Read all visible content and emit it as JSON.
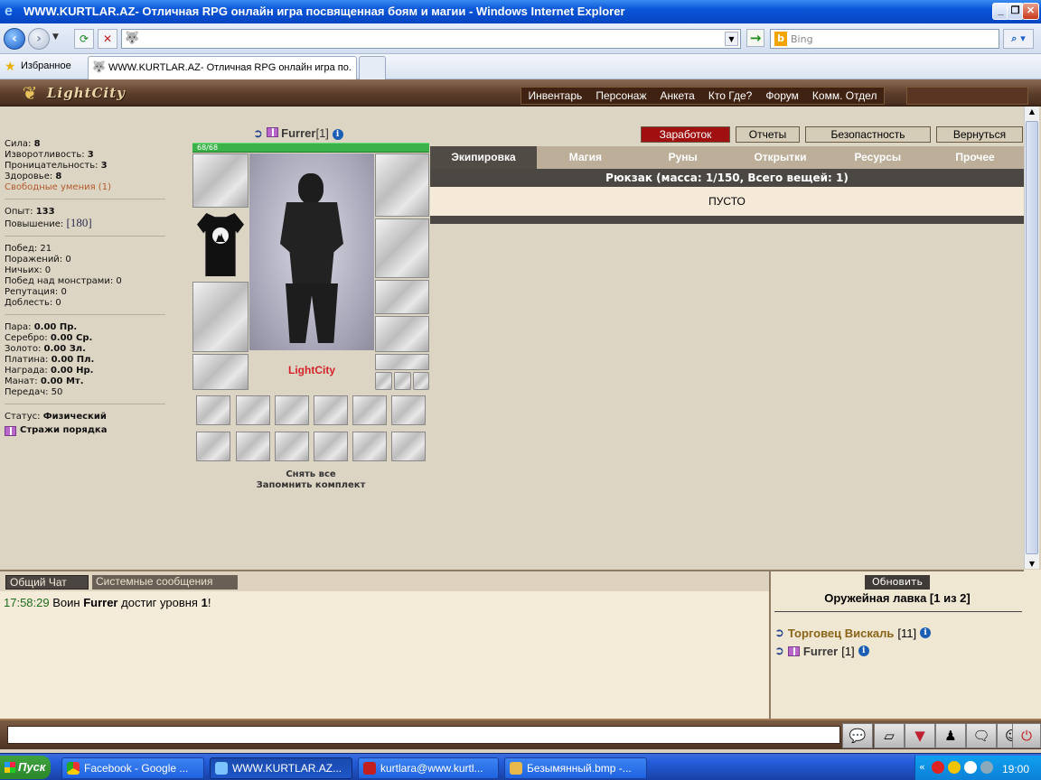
{
  "browser": {
    "title": "WWW.KURTLAR.AZ- Отличная RPG онлайн игра посвященная боям и магии - Windows Internet Explorer",
    "search_placeholder": "Bing",
    "favorites_label": "Избранное",
    "tab_title": "WWW.KURTLAR.AZ- Отличная RPG онлайн игра по..."
  },
  "game": {
    "logo": "LightCity",
    "menu": [
      "Инвентарь",
      "Персонаж",
      "Анкета",
      "Кто Где?",
      "Форум",
      "Комм. Отдел"
    ]
  },
  "stats": {
    "strength_label": "Сила:",
    "strength": "8",
    "agility_label": "Изворотливость:",
    "agility": "3",
    "insight_label": "Проницательность:",
    "insight": "3",
    "health_label": "Здоровье:",
    "health": "8",
    "free_skills": "Свободные умения (1)",
    "exp_label": "Опыт:",
    "exp": "133",
    "levelup_label": "Повышение:",
    "levelup": "[180]",
    "wins": "Побед: 21",
    "losses": "Поражений: 0",
    "draws": "Ничьих: 0",
    "monster_wins": "Побед над монстрами: 0",
    "reputation": "Репутация: 0",
    "valor": "Доблесть: 0",
    "para_label": "Пара:",
    "para": "0.00 Пр.",
    "silver_label": "Серебро:",
    "silver": "0.00 Ср.",
    "gold_label": "Золото:",
    "gold": "0.00 Зл.",
    "platinum_label": "Платина:",
    "platinum": "0.00 Пл.",
    "reward_label": "Награда:",
    "reward": "0.00 Нр.",
    "manat_label": "Манат:",
    "manat": "0.00 Мт.",
    "transfers": "Передач: 50",
    "status_label": "Статус:",
    "status": "Физический",
    "guild": "Стражи порядка"
  },
  "character": {
    "name": "Furrer",
    "level": "[1]",
    "hp_text": "68/68",
    "hp_fraction": 1.0,
    "city_label": "LightCity",
    "undress_all": "Снять все",
    "remember_set": "Запомнить комплект"
  },
  "buttons": {
    "earnings": "Заработок",
    "reports": "Отчеты",
    "security": "Безопастность",
    "return": "Вернуться"
  },
  "inventory": {
    "tabs": [
      "Экипировка",
      "Магия",
      "Руны",
      "Открытки",
      "Ресурсы",
      "Прочее"
    ],
    "backpack_header": "Рюкзак (масса: 1/150, Всего вещей: 1)",
    "empty": "ПУСТО"
  },
  "chat": {
    "tab_general": "Общий Чат",
    "tab_system": "Системные сообщения",
    "msg_time": "17:58:29",
    "msg_pre": "Воин",
    "msg_name": "Furrer",
    "msg_mid": "достиг уровня",
    "msg_level": "1",
    "msg_end": "!"
  },
  "shop": {
    "refresh": "Обновить",
    "title": "Оружейная лавка [1 из 2]",
    "merchant_name": "Торговец Вискаль",
    "merchant_level": "[11]",
    "player_name": "Furrer",
    "player_level": "[1]"
  },
  "taskbar": {
    "start": "Пуск",
    "tasks": [
      "Facebook - Google ...",
      "WWW.KURTLAR.AZ...",
      "kurtlara@www.kurtl...",
      "Безымянный.bmp -..."
    ],
    "clock": "19:00"
  },
  "colors": {
    "accent_red": "#a01010",
    "hp_green": "#3bb34a"
  }
}
